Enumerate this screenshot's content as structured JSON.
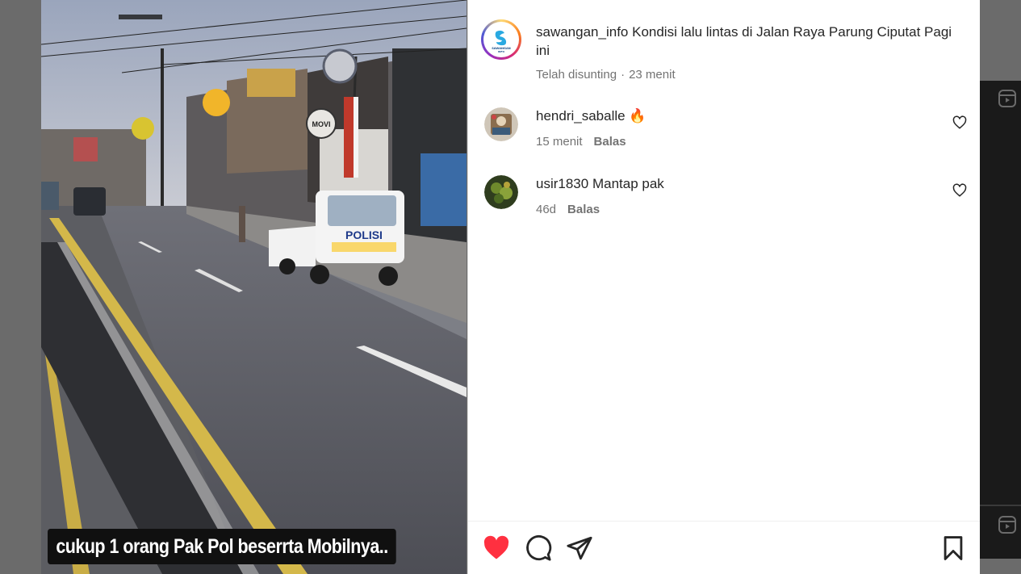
{
  "media": {
    "caption_overlay": "cukup 1 orang Pak Pol beserrta Mobilnya..",
    "vehicle_text": "POLISI",
    "sign_text": "MOVI"
  },
  "post": {
    "username": "sawangan_info",
    "caption": "Kondisi lalu lintas di Jalan Raya Parung Ciputat Pagi ini",
    "edited_label": "Telah disunting",
    "separator": "·",
    "time": "23 menit",
    "avatar_text_top": "SAWANGAN",
    "avatar_text_bottom": "INFO"
  },
  "comments": [
    {
      "username": "hendri_saballe",
      "text": "🔥",
      "time": "15 menit",
      "reply_label": "Balas"
    },
    {
      "username": "usir1830",
      "text": "Mantap pak",
      "time": "46d",
      "reply_label": "Balas"
    }
  ],
  "icons": {
    "like": "heart-filled-icon",
    "comment": "comment-bubble-icon",
    "share": "paper-plane-icon",
    "save": "bookmark-icon",
    "comment_like": "heart-outline-icon",
    "reel": "reels-icon"
  },
  "colors": {
    "like_red": "#ff3040",
    "text_primary": "#262626",
    "text_secondary": "#737373"
  }
}
